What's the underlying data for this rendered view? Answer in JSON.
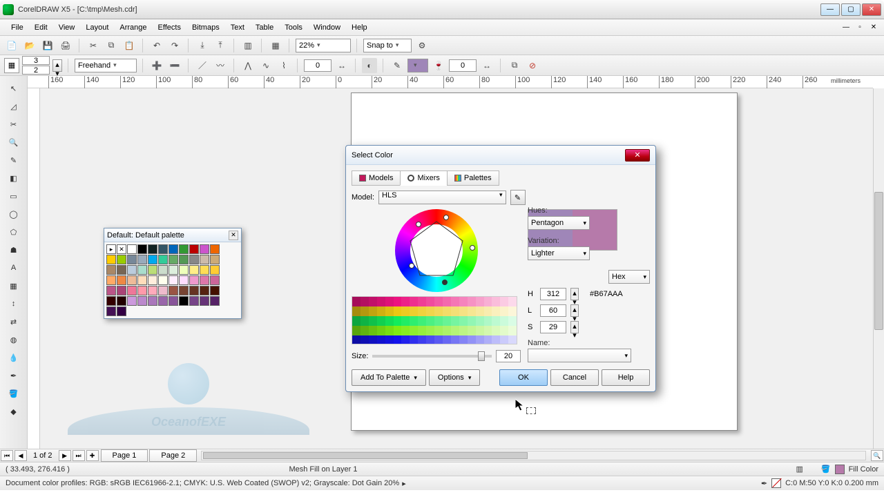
{
  "window": {
    "title": "CorelDRAW X5 - [C:\\tmp\\Mesh.cdr]"
  },
  "menu": {
    "items": [
      "File",
      "Edit",
      "View",
      "Layout",
      "Arrange",
      "Effects",
      "Bitmaps",
      "Text",
      "Table",
      "Tools",
      "Window",
      "Help"
    ]
  },
  "toolbar1": {
    "zoom": "22%",
    "snap": "Snap to"
  },
  "propbar": {
    "grid_cols": "3",
    "grid_rows": "2",
    "tool_combo": "Freehand",
    "node_count": "0",
    "outline_val": "0"
  },
  "ruler": {
    "unit_label": "millimeters",
    "ticks": [
      "160",
      "140",
      "120",
      "100",
      "80",
      "60",
      "40",
      "20",
      "0",
      "20",
      "40",
      "60",
      "80",
      "100",
      "120",
      "140",
      "160",
      "180",
      "200",
      "220",
      "240",
      "260"
    ]
  },
  "palette_panel": {
    "title": "Default: Default palette"
  },
  "dialog": {
    "title": "Select Color",
    "tabs": {
      "models": "Models",
      "mixers": "Mixers",
      "palettes": "Palettes"
    },
    "model_label": "Model:",
    "model_value": "HLS",
    "hues_label": "Hues:",
    "hues_value": "Pentagon",
    "variation_label": "Variation:",
    "variation_value": "Lighter",
    "hex_mode": "Hex",
    "hex_value": "#B67AAA",
    "H": "312",
    "L": "60",
    "S": "29",
    "name_label": "Name:",
    "name_value": "",
    "size_label": "Size:",
    "size_value": "20",
    "btn_add": "Add To Palette",
    "btn_options": "Options",
    "btn_ok": "OK",
    "btn_cancel": "Cancel",
    "btn_help": "Help"
  },
  "pagenav": {
    "counter": "1 of 2",
    "page1": "Page 1",
    "page2": "Page 2"
  },
  "status": {
    "coords": "( 33.493, 276.416 )",
    "center": "Mesh Fill on Layer 1",
    "fill_label": "Fill Color",
    "profiles": "Document color profiles: RGB: sRGB IEC61966-2.1; CMYK: U.S. Web Coated (SWOP) v2; Grayscale: Dot Gain 20%",
    "cmyk": "C:0 M:50 Y:0 K:0  0.200 mm"
  },
  "watermark": {
    "text": "OceanofEXE"
  }
}
